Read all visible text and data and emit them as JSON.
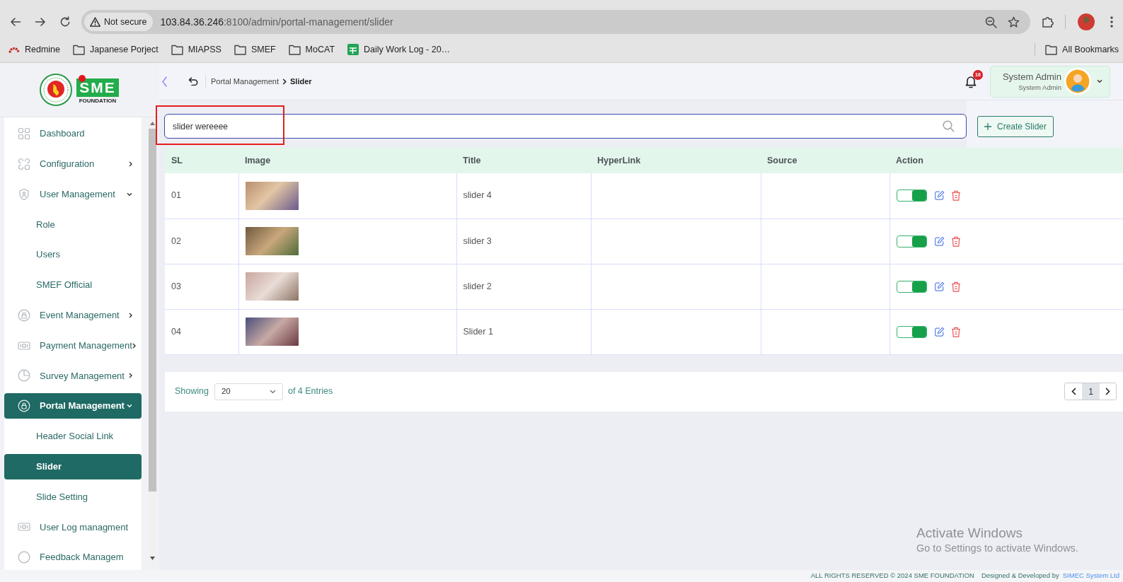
{
  "browser": {
    "security_label": "Not secure",
    "url": {
      "host": "103.84.36.246",
      "rest": ":8100/admin/portal-management/slider"
    },
    "bookmarks": [
      {
        "kind": "site",
        "label": "Redmine"
      },
      {
        "kind": "folder",
        "label": "Japanese Porject"
      },
      {
        "kind": "folder",
        "label": "MIAPSS"
      },
      {
        "kind": "folder",
        "label": "SMEF"
      },
      {
        "kind": "folder",
        "label": "MoCAT"
      },
      {
        "kind": "site",
        "label": "Daily Work Log - 20…"
      }
    ],
    "all_bookmarks": "All Bookmarks"
  },
  "logo": {
    "mark": "SME",
    "caption": "FOUNDATION"
  },
  "sidebar": {
    "items": [
      {
        "kind": "link",
        "label": "Dashboard",
        "selected": false
      },
      {
        "kind": "group",
        "label": "Configuration",
        "expanded": false,
        "selected": false
      },
      {
        "kind": "group",
        "label": "User Management",
        "expanded": true,
        "selected": false,
        "children": [
          {
            "label": "Role",
            "selected": false
          },
          {
            "label": "Users",
            "selected": false
          },
          {
            "label": "SMEF Official",
            "selected": false
          }
        ]
      },
      {
        "kind": "group",
        "label": "Event Management",
        "expanded": false,
        "selected": false
      },
      {
        "kind": "group",
        "label": "Payment Management",
        "expanded": false,
        "selected": false
      },
      {
        "kind": "group",
        "label": "Survey Management",
        "expanded": false,
        "selected": false
      },
      {
        "kind": "group",
        "label": "Portal Management",
        "expanded": true,
        "selected": true,
        "children": [
          {
            "label": "Header Social Link",
            "selected": false
          },
          {
            "label": "Slider",
            "selected": true
          },
          {
            "label": "Slide Setting",
            "selected": false
          }
        ]
      },
      {
        "kind": "link",
        "label": "User Log managment",
        "selected": false
      },
      {
        "kind": "link",
        "label": "Feedback Managem",
        "selected": false
      }
    ]
  },
  "header": {
    "breadcrumb": [
      {
        "label": "Portal Management"
      },
      {
        "label": "Slider"
      }
    ],
    "notifications": {
      "count": "16"
    },
    "user": {
      "name": "System Admin",
      "role": "System Admin"
    }
  },
  "search": {
    "value": "slider wereeee",
    "highlighted": true
  },
  "create_button": "Create Slider",
  "table": {
    "columns": [
      "SL",
      "Image",
      "Title",
      "HyperLink",
      "Source",
      "Action"
    ],
    "rows": [
      {
        "sl": "01",
        "title": "slider 4",
        "on": true
      },
      {
        "sl": "02",
        "title": "slider 3",
        "on": true
      },
      {
        "sl": "03",
        "title": "slider 2",
        "on": true
      },
      {
        "sl": "04",
        "title": "Slider 1",
        "on": true
      }
    ]
  },
  "pagination": {
    "showing_label": "Showing",
    "page_size": "20",
    "total_label": "of 4 Entries",
    "pages": [
      {
        "label": "1",
        "selected": true
      }
    ]
  },
  "footer": {
    "rights": "ALL RIGHTS RESERVED © 2024 SME FOUNDATION",
    "credit": "Designed & Developed by",
    "developer": "SIMEC System Ltd"
  },
  "os_watermark": {
    "title": "Activate Windows",
    "subtitle": "Go to Settings to activate Windows."
  }
}
